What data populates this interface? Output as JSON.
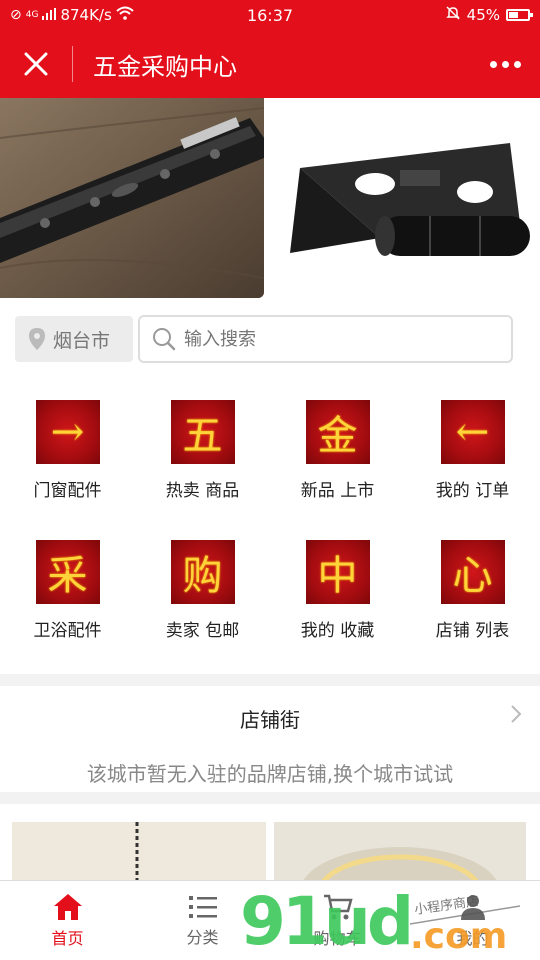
{
  "status": {
    "network": "4G",
    "speed": "874K/s",
    "time": "16:37",
    "battery": "45%"
  },
  "header": {
    "title": "五金采购中心"
  },
  "search": {
    "city": "烟台市",
    "placeholder": "输入搜索"
  },
  "grid": [
    {
      "glyph": "→",
      "label": "门窗配件"
    },
    {
      "glyph": "五",
      "label": "热卖 商品"
    },
    {
      "glyph": "金",
      "label": "新品 上市"
    },
    {
      "glyph": "←",
      "label": "我的 订单"
    },
    {
      "glyph": "采",
      "label": "卫浴配件"
    },
    {
      "glyph": "购",
      "label": "卖家 包邮"
    },
    {
      "glyph": "中",
      "label": "我的 收藏"
    },
    {
      "glyph": "心",
      "label": "店铺 列表"
    }
  ],
  "shop_street": {
    "title": "店铺街",
    "empty_message": "该城市暂无入驻的品牌店铺,换个城市试试"
  },
  "bottom_nav": [
    {
      "label": "首页",
      "icon": "home-icon",
      "active": true
    },
    {
      "label": "分类",
      "icon": "list-icon",
      "active": false
    },
    {
      "label": "购物车",
      "icon": "cart-icon",
      "active": false
    },
    {
      "label": "我的",
      "icon": "user-icon",
      "active": false
    }
  ],
  "watermark": {
    "text": "91ud",
    "domain": ".com",
    "tag": "小程序商店"
  },
  "colors": {
    "primary": "#e3101c",
    "icon_bg": "#b50f13",
    "icon_glyph": "#ffd43a",
    "watermark_green": "#3cc85a",
    "watermark_orange": "#f59a23"
  }
}
